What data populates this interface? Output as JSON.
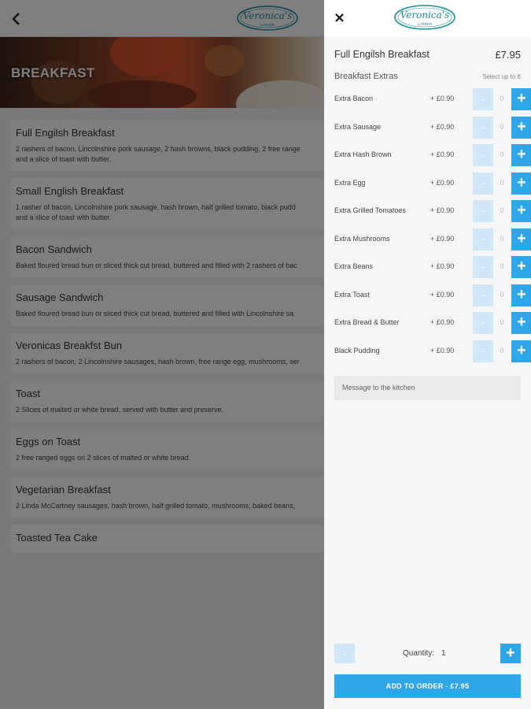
{
  "menu": {
    "logo": {
      "text_top": "Veronica's",
      "text_bottom": "LARDER",
      "color": "#1a8f9c"
    },
    "hero_title": "BREAKFAST",
    "items": [
      {
        "name": "Full Engilsh Breakfast",
        "desc": [
          "2 rashers of bacon, Lincolnshire pork sausage, 2 hash browns, black pudding, 2 free range",
          "and a slice of toast with butter."
        ]
      },
      {
        "name": "Small English Breakfast",
        "desc": [
          "1 rasher of bacon, Lincolnshire pork sausage, hash brown, half grilled tomato, black pudd",
          "and a slice of toast with butter."
        ]
      },
      {
        "name": "Bacon Sandwich",
        "desc": [
          "Baked floured bread bun or sliced thick cut bread, buttered and filled with 2 rashers of bac"
        ]
      },
      {
        "name": "Sausage Sandwich",
        "desc": [
          "Baked floured bread bun or sliced thick cut bread, buttered and filled with Lincolnshire sa"
        ]
      },
      {
        "name": "Veronicas Breakfst Bun",
        "desc": [
          "2 rashers of bacon, 2 Lincolnshire sausages, hash brown, free range egg, mushrooms, ser"
        ]
      },
      {
        "name": "Toast",
        "desc": [
          "2 Slices of malted or white bread, served with butter and preserve."
        ]
      },
      {
        "name": "Eggs on Toast",
        "desc": [
          "2 free ranged eggs on 2 slices of malted or white bread."
        ]
      },
      {
        "name": "Vegetarian Breakfast",
        "desc": [
          "2 Linda McCartney sausages, hash brown, half grilled tomato, mushrooms, baked beans, "
        ]
      },
      {
        "name": "Toasted Tea Cake",
        "desc": []
      }
    ]
  },
  "panel": {
    "item_name": "Full Engilsh Breakfast",
    "item_price": "£7.95",
    "extras_title": "Breakfast Extras",
    "extras_note": "Select up to 8",
    "extras": [
      {
        "name": "Extra Bacon",
        "price": "+ £0.90",
        "qty": "0"
      },
      {
        "name": "Extra Sausage",
        "price": "+ £0.90",
        "qty": "0"
      },
      {
        "name": "Extra Hash Brown",
        "price": "+ £0.90",
        "qty": "0"
      },
      {
        "name": "Extra Egg",
        "price": "+ £0.90",
        "qty": "0"
      },
      {
        "name": "Extra Grilled Tomatoes",
        "price": "+ £0.90",
        "qty": "0"
      },
      {
        "name": "Extra Mushrooms",
        "price": "+ £0.90",
        "qty": "0"
      },
      {
        "name": "Extra Beans",
        "price": "+ £0.90",
        "qty": "0"
      },
      {
        "name": "Extra Toast",
        "price": "+ £0.90",
        "qty": "0"
      },
      {
        "name": "Extra Bread & Butter",
        "price": "+ £0.90",
        "qty": "0"
      },
      {
        "name": "Black Pudding",
        "price": "+ £0.90",
        "qty": "0"
      }
    ],
    "minus_symbol": "-",
    "plus_symbol": "+",
    "message_placeholder": "Message to the kitchen",
    "quantity_label": "Quantity:",
    "quantity_value": "1",
    "add_button": "ADD TO ORDER  -  £7.95",
    "accent_color": "#2fa6e8",
    "disabled_color": "#cfe7f7"
  }
}
